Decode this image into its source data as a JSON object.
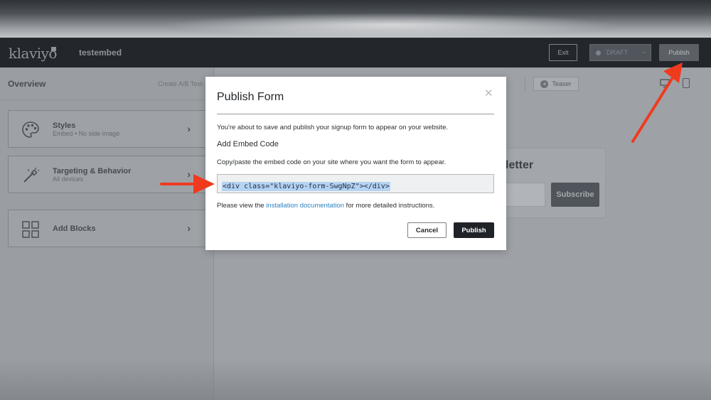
{
  "header": {
    "logo_text": "klaviyo",
    "form_name": "testembed",
    "exit_label": "Exit",
    "status_label": "DRAFT",
    "publish_label": "Publish"
  },
  "sidebar": {
    "title": "Overview",
    "ab_test_label": "Create A/B Test",
    "items": [
      {
        "title": "Styles",
        "subtitle": "Embed • No side image",
        "icon": "palette-icon"
      },
      {
        "title": "Targeting & Behavior",
        "subtitle": "All devices",
        "icon": "magic-wand-icon"
      },
      {
        "title": "Add Blocks",
        "icon": "blocks-grid-icon"
      }
    ]
  },
  "toolbar": {
    "teaser_label": "Teaser",
    "teaser_icon": "plus-circle-icon",
    "device_icon": "mobile-icon"
  },
  "preview": {
    "heading_fragment": "letter",
    "subscribe_label": "Subscribe"
  },
  "modal": {
    "title": "Publish Form",
    "description": "You're about to save and publish your signup form to appear on your website.",
    "section_title": "Add Embed Code",
    "copy_instruction": "Copy/paste the embed code on your site where you want the form to appear.",
    "embed_code": "<div class=\"klaviyo-form-SwgNpZ\"></div>",
    "note_prefix": "Please view the ",
    "note_link": "installation documentation",
    "note_suffix": " for more detailed instructions.",
    "cancel_label": "Cancel",
    "publish_label": "Publish",
    "close_icon": "close-icon"
  },
  "colors": {
    "annotation_arrow": "#f03a1e",
    "link": "#2d84c1",
    "primary_button": "#1f2227",
    "selection_highlight": "#b5d3f3"
  }
}
